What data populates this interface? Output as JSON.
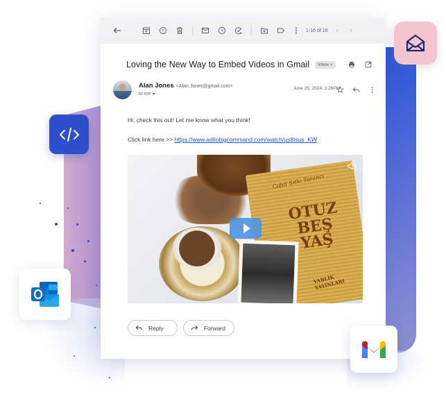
{
  "toolbar": {
    "icons": [
      "back-arrow-icon",
      "archive-icon",
      "report-spam-icon",
      "delete-icon",
      "mark-unread-icon",
      "snooze-icon",
      "add-task-icon",
      "move-to-icon",
      "label-icon",
      "more-options-icon"
    ],
    "pager": "1-16 of 16",
    "prev": "‹",
    "next": "›"
  },
  "email": {
    "subject": "Loving the New Way to Embed Videos in Gmail",
    "label_chip": "Inbox ×",
    "sender_name": "Alan Jones",
    "sender_email": "<Alan Jones@gmail.com>",
    "recipient": "to me",
    "recipient_caret": "▾",
    "date": "June 25, 2024, 3:26PM",
    "body_line": "Hi, check this out! Let me know what you think!",
    "link_prefix": "Click link here >> ",
    "link_text": "https://www.adilobigcommand.com/watch/us8Isus_KW",
    "video": {
      "book_author": "Cahit Sıtkı Tarancı",
      "book_title": "OTUZ BEŞ YAŞ",
      "book_publisher": "VARLIK YAYINLARI"
    }
  },
  "actions": {
    "reply": "Reply",
    "forward": "Forward"
  },
  "badges": {
    "mail": "open-envelope-icon",
    "code": "code-icon",
    "outlook": "outlook-logo",
    "gmail": "gmail-logo"
  },
  "colors": {
    "link": "#1a57c8",
    "code_badge": "#2d4fcc",
    "mail_badge": "#f4c4d0",
    "play_button": "#4f93e0"
  }
}
